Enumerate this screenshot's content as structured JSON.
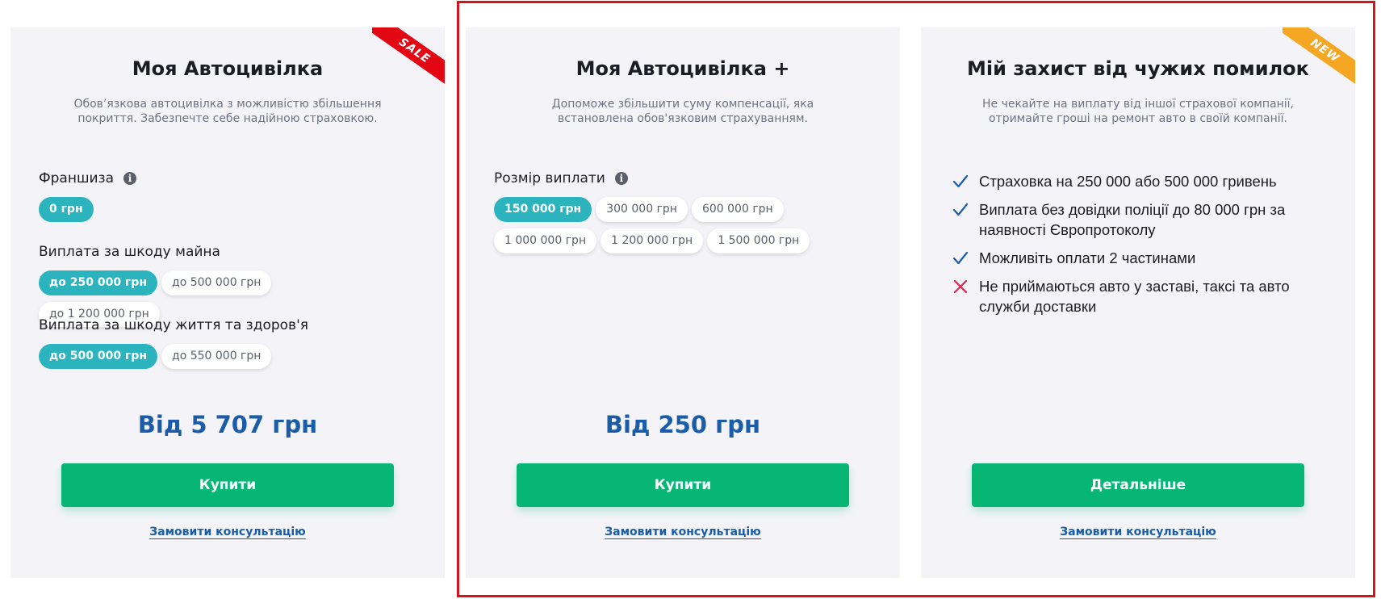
{
  "cards": [
    {
      "ribbon": "SALE",
      "title": "Моя Автоцивілка",
      "description": "Обов’язкова автоцивілка з можливістю збільшення покриття. Забезпечте себе надійною страховкою.",
      "groups": [
        {
          "label": "Франшиза",
          "info": true,
          "options": [
            "0 грн"
          ],
          "selected": "0 грн"
        },
        {
          "label": "Виплата за шкоду майна",
          "info": false,
          "options": [
            "до 250 000 грн",
            "до 500 000 грн",
            "до 1 200 000 грн"
          ],
          "selected": "до 250 000 грн"
        },
        {
          "label": "Виплата за шкоду життя та здоров'я",
          "info": false,
          "options": [
            "до 500 000 грн",
            "до 550 000 грн"
          ],
          "selected": "до 500 000 грн"
        }
      ],
      "price": "Від 5 707 грн",
      "button": "Купити",
      "consult": "Замовити консультацію"
    },
    {
      "title": "Моя Автоцивілка +",
      "description": "Допоможе збільшити суму компенсації, яка встановлена обов'язковим страхуванням.",
      "groups": [
        {
          "label": "Розмір виплати",
          "info": true,
          "options": [
            "150 000 грн",
            "300 000 грн",
            "600 000 грн",
            "1 000 000 грн",
            "1 200 000 грн",
            "1 500 000 грн"
          ],
          "selected": "150 000 грн"
        }
      ],
      "price": "Від 250 грн",
      "button": "Купити",
      "consult": "Замовити консультацію"
    },
    {
      "ribbon": "NEW",
      "title": "Мій захист від чужих помилок",
      "description": "Не чекайте на виплату від іншої страхової компанії, отримайте гроші на ремонт авто в своїй компанії.",
      "features": [
        {
          "icon": "check-icon",
          "text": "Страховка на 250 000 або 500 000 гривень"
        },
        {
          "icon": "check-icon",
          "text": "Виплата без довідки поліції до 80 000 грн за наявності Європротоколу"
        },
        {
          "icon": "check-icon",
          "text": "Можливіть оплати 2 частинами"
        },
        {
          "icon": "cross-icon",
          "text": "Не приймаються авто у заставі, таксі та авто служби доставки"
        }
      ],
      "button": "Детальніше",
      "consult": "Замовити консультацію"
    }
  ],
  "colors": {
    "accent_teal": "#2bb4be",
    "button_green": "#07b574",
    "price_blue": "#1a5ca8",
    "highlight_red": "#d7141c",
    "ribbon_sale": "#e30613",
    "ribbon_new": "#f5a623",
    "check_blue": "#1a5ca8",
    "cross_red": "#e2264d"
  }
}
